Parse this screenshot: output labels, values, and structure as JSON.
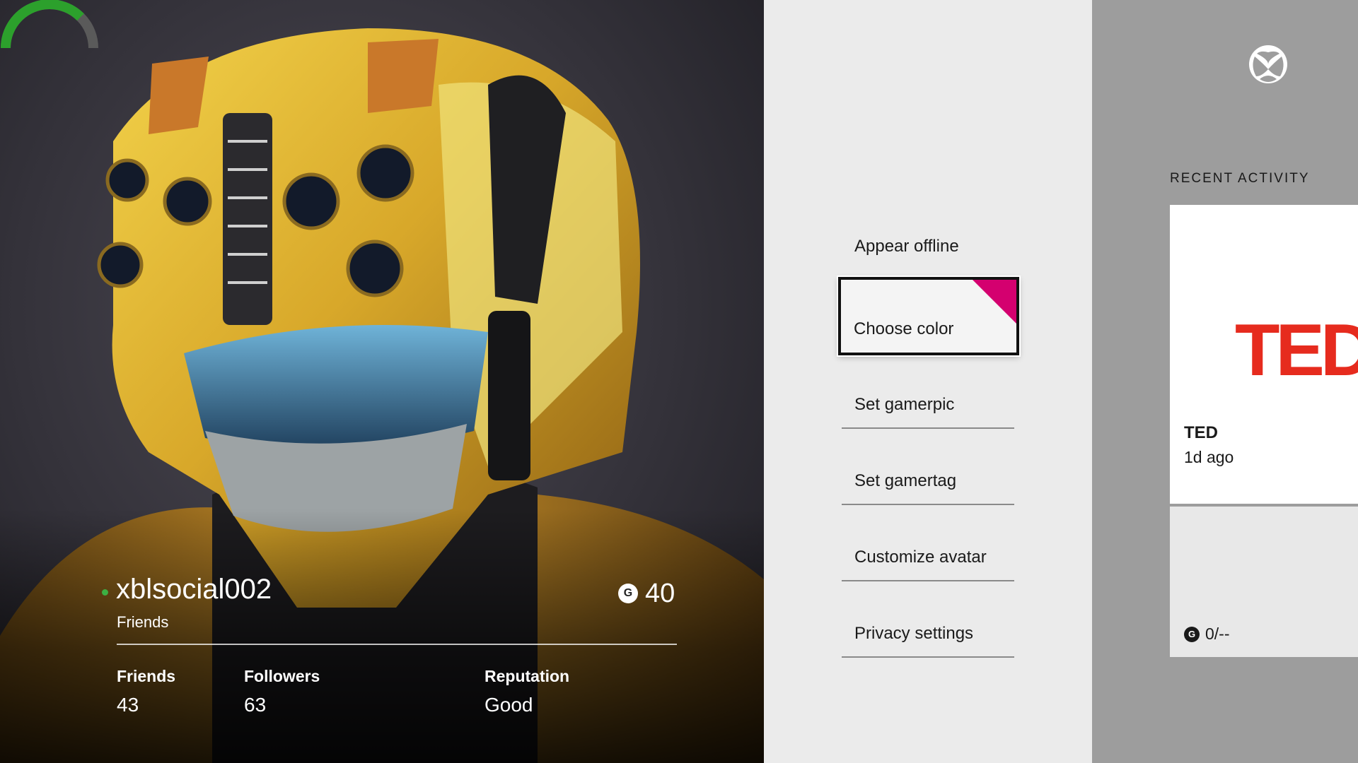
{
  "profile": {
    "gamertag": "xblsocial002",
    "relationship": "Friends",
    "gamerscore": "40",
    "gamerscore_icon": "G",
    "presence_color": "#3cb043",
    "stats": {
      "friends_label": "Friends",
      "friends_value": "43",
      "followers_label": "Followers",
      "followers_value": "63",
      "reputation_label": "Reputation",
      "reputation_value": "Good",
      "reputation_level": 0.75,
      "reputation_color": "#2ca02c"
    }
  },
  "menu": {
    "items": [
      {
        "label": "Appear offline"
      },
      {
        "label": "Choose color"
      },
      {
        "label": "Set gamerpic"
      },
      {
        "label": "Set gamertag"
      },
      {
        "label": "Customize avatar"
      },
      {
        "label": "Privacy settings"
      }
    ],
    "accent_color": "#d4006f"
  },
  "activity": {
    "header": "RECENT ACTIVITY",
    "card": {
      "logo_text": "TED",
      "title": "TED",
      "time": "1d ago",
      "score_icon": "G",
      "score": "0/--"
    }
  },
  "icons": {
    "xbox": "xbox-logo-icon",
    "gamerscore": "gamerscore-icon",
    "presence": "online-presence-icon"
  }
}
